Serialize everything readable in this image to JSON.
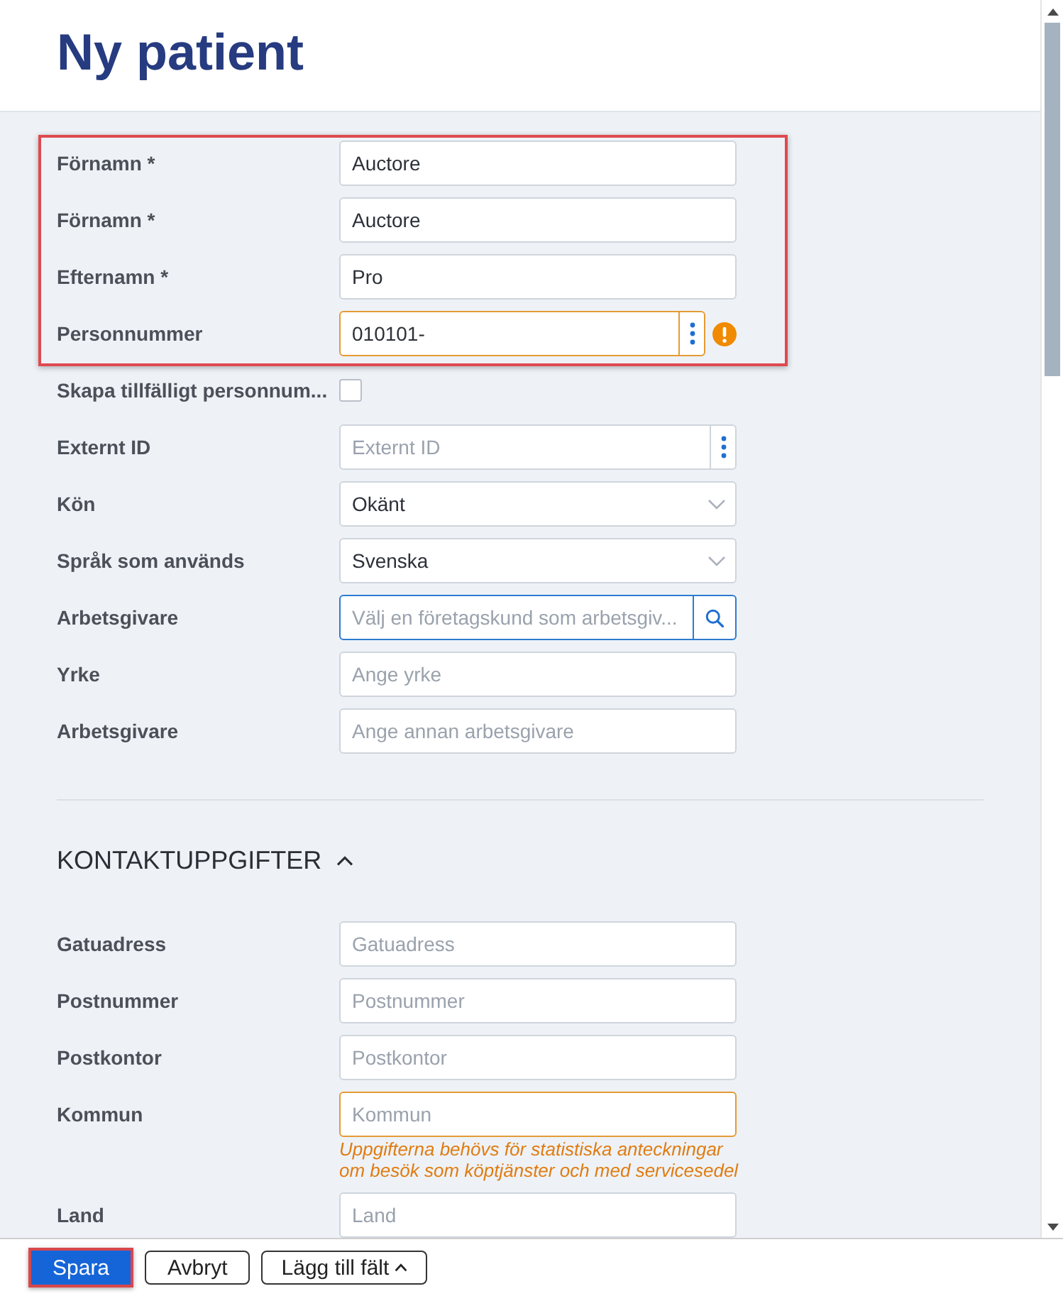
{
  "header": {
    "title": "Ny patient"
  },
  "personal": {
    "fields": [
      {
        "kind": "text",
        "label": "Förnamn *",
        "value": "Auctore",
        "warning": false,
        "highlighted": true
      },
      {
        "kind": "text",
        "label": "Förnamn *",
        "value": "Auctore",
        "warning": false,
        "highlighted": true
      },
      {
        "kind": "text",
        "label": "Efternamn *",
        "value": "Pro",
        "warning": false,
        "highlighted": true
      },
      {
        "kind": "text_menu",
        "label": "Personnummer",
        "value": "010101-",
        "warning": true,
        "highlighted": true
      },
      {
        "kind": "checkbox",
        "label": "Skapa tillfälligt personnum...",
        "checked": false,
        "warning": false,
        "highlighted": false
      },
      {
        "kind": "text_menu",
        "label": "Externt ID",
        "placeholder": "Externt ID",
        "warning": false,
        "highlighted": false
      },
      {
        "kind": "select",
        "label": "Kön",
        "value": "Okänt",
        "warning": false,
        "highlighted": false
      },
      {
        "kind": "select",
        "label": "Språk som används",
        "value": "Svenska",
        "warning": false,
        "highlighted": false
      },
      {
        "kind": "search",
        "label": "Arbetsgivare",
        "placeholder": "Välj en företagskund som arbetsgiv...",
        "warning": false,
        "highlighted": false
      },
      {
        "kind": "text",
        "label": "Yrke",
        "placeholder": "Ange yrke",
        "warning": false,
        "highlighted": false
      },
      {
        "kind": "text",
        "label": "Arbetsgivare",
        "placeholder": "Ange annan arbetsgivare",
        "warning": false,
        "highlighted": false
      }
    ]
  },
  "contact": {
    "title": "KONTAKTUPPGIFTER",
    "expanded": true,
    "fields": [
      {
        "kind": "text",
        "label": "Gatuadress",
        "placeholder": "Gatuadress",
        "warning": false,
        "highlighted": false
      },
      {
        "kind": "text",
        "label": "Postnummer",
        "placeholder": "Postnummer",
        "warning": false,
        "highlighted": false
      },
      {
        "kind": "text",
        "label": "Postkontor",
        "placeholder": "Postkontor",
        "warning": false,
        "highlighted": false
      },
      {
        "kind": "text",
        "label": "Kommun",
        "placeholder": "Kommun",
        "warning": true,
        "hint": "Uppgifterna behövs för statistiska anteckningar om besök som köptjänster och med servicesedel",
        "highlighted": false
      },
      {
        "kind": "text",
        "label": "Land",
        "placeholder": "Land",
        "warning": false,
        "highlighted": false
      }
    ]
  },
  "footer": {
    "buttons": [
      {
        "kind": "primary",
        "label": "Spara",
        "highlighted": true
      },
      {
        "kind": "secondary",
        "label": "Avbryt",
        "highlighted": false
      },
      {
        "kind": "menu",
        "label": "Lägg till fält",
        "highlighted": false
      }
    ]
  }
}
